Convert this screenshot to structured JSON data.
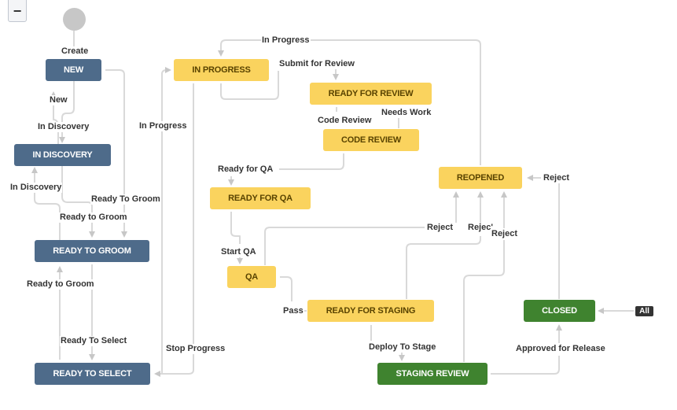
{
  "controls": {
    "zoom_out_label": "−"
  },
  "colors": {
    "todo": "#4e6b8a",
    "in_progress": "#fad35e",
    "done": "#3f832f",
    "line": "#d9d9d9",
    "arrow": "#c7c7c7"
  },
  "statuses": {
    "new": "NEW",
    "in_discovery": "IN DISCOVERY",
    "ready_to_groom": "READY TO GROOM",
    "ready_to_select": "READY TO SELECT",
    "in_progress": "IN PROGRESS",
    "ready_for_review": "READY FOR REVIEW",
    "code_review": "CODE REVIEW",
    "ready_for_qa": "READY FOR QA",
    "qa": "QA",
    "ready_for_staging": "READY FOR STAGING",
    "staging_review": "STAGING REVIEW",
    "reopened": "REOPENED",
    "closed": "CLOSED"
  },
  "transitions": {
    "create": "Create",
    "new": "New",
    "in_discovery_1": "In Discovery",
    "in_discovery_2": "In Discovery",
    "ready_to_groom_1": "Ready To Groom",
    "ready_to_groom_2": "Ready to Groom",
    "ready_to_groom_3": "Ready to Groom",
    "ready_to_select": "Ready To Select",
    "in_progress_1": "In Progress",
    "in_progress_2": "In Progress",
    "stop_progress": "Stop Progress",
    "submit_for_review": "Submit for Review",
    "code_review": "Code Review",
    "needs_work": "Needs Work",
    "ready_for_qa": "Ready for QA",
    "start_qa": "Start QA",
    "pass": "Pass",
    "deploy_to_stage": "Deploy To Stage",
    "approved_for_release": "Approved for Release",
    "reject_1": "Reject",
    "reject_2": "Rejec'",
    "reject_3": "Reject",
    "reject_4": "Reject"
  },
  "global_transition_badge": "All"
}
